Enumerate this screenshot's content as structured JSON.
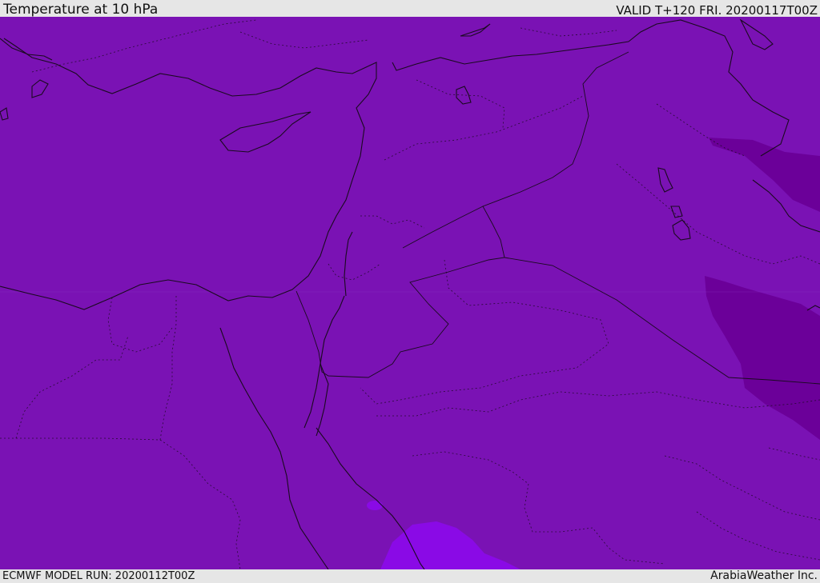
{
  "header": {
    "title": "Temperature at 10 hPa",
    "valid": "VALID T+120 FRI. 20200117T00Z"
  },
  "footer": {
    "model_run": "ECMWF MODEL RUN: 20200112T00Z",
    "credit": "ArabiaWeather Inc."
  },
  "colors": {
    "background_field": "#7a12b4",
    "cold_core": "#6b0099",
    "warm_patch": "#8a0ae6",
    "outline": "#1a0a1f"
  }
}
